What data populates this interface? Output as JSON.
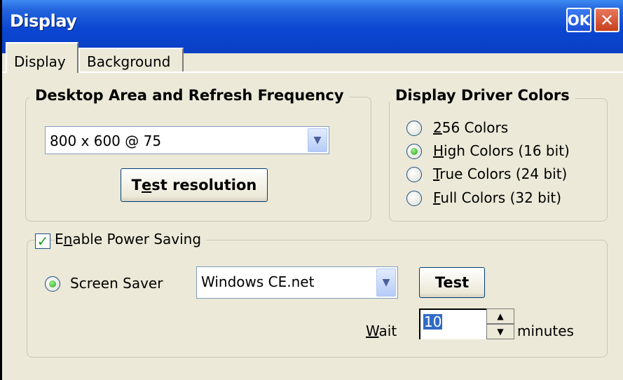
{
  "window": {
    "title": "Display",
    "ok_label": "OK",
    "close_glyph": "✕"
  },
  "tabs": [
    {
      "label": "Display",
      "selected": true
    },
    {
      "label": "Background",
      "selected": false
    }
  ],
  "desktop_area": {
    "legend": "Desktop Area and Refresh Frequency",
    "resolution_value": "800 x 600 @ 75",
    "test_button": {
      "before": "T",
      "accel": "e",
      "after": "st resolution"
    }
  },
  "color_depth": {
    "legend": "Display Driver Colors",
    "options": [
      {
        "accel": "2",
        "rest": "56 Colors",
        "selected": false
      },
      {
        "accel": "H",
        "rest": "igh Colors (16 bit)",
        "selected": true
      },
      {
        "accel": "T",
        "rest": "rue Colors (24 bit)",
        "selected": false
      },
      {
        "accel": "F",
        "rest": "ull  Colors (32 bit)",
        "selected": false
      }
    ]
  },
  "power_saving": {
    "checkbox": {
      "before": "E",
      "accel": "n",
      "after": "able Power Saving",
      "checked": true
    },
    "screen_saver_label": "Screen Saver",
    "screen_saver_value": "Windows CE.net",
    "test_label": "Test",
    "wait_label": {
      "accel": "W",
      "rest": "ait"
    },
    "wait_value": "10",
    "minutes_label": "minutes"
  },
  "colors": {
    "title_bar": "#0a46d1",
    "face": "#ece9d8",
    "radio_on": "#21a121",
    "selection": "#316ac5"
  },
  "icons": [
    "chevron-down-icon",
    "close-icon",
    "spin-up-icon",
    "spin-down-icon",
    "check-icon"
  ]
}
